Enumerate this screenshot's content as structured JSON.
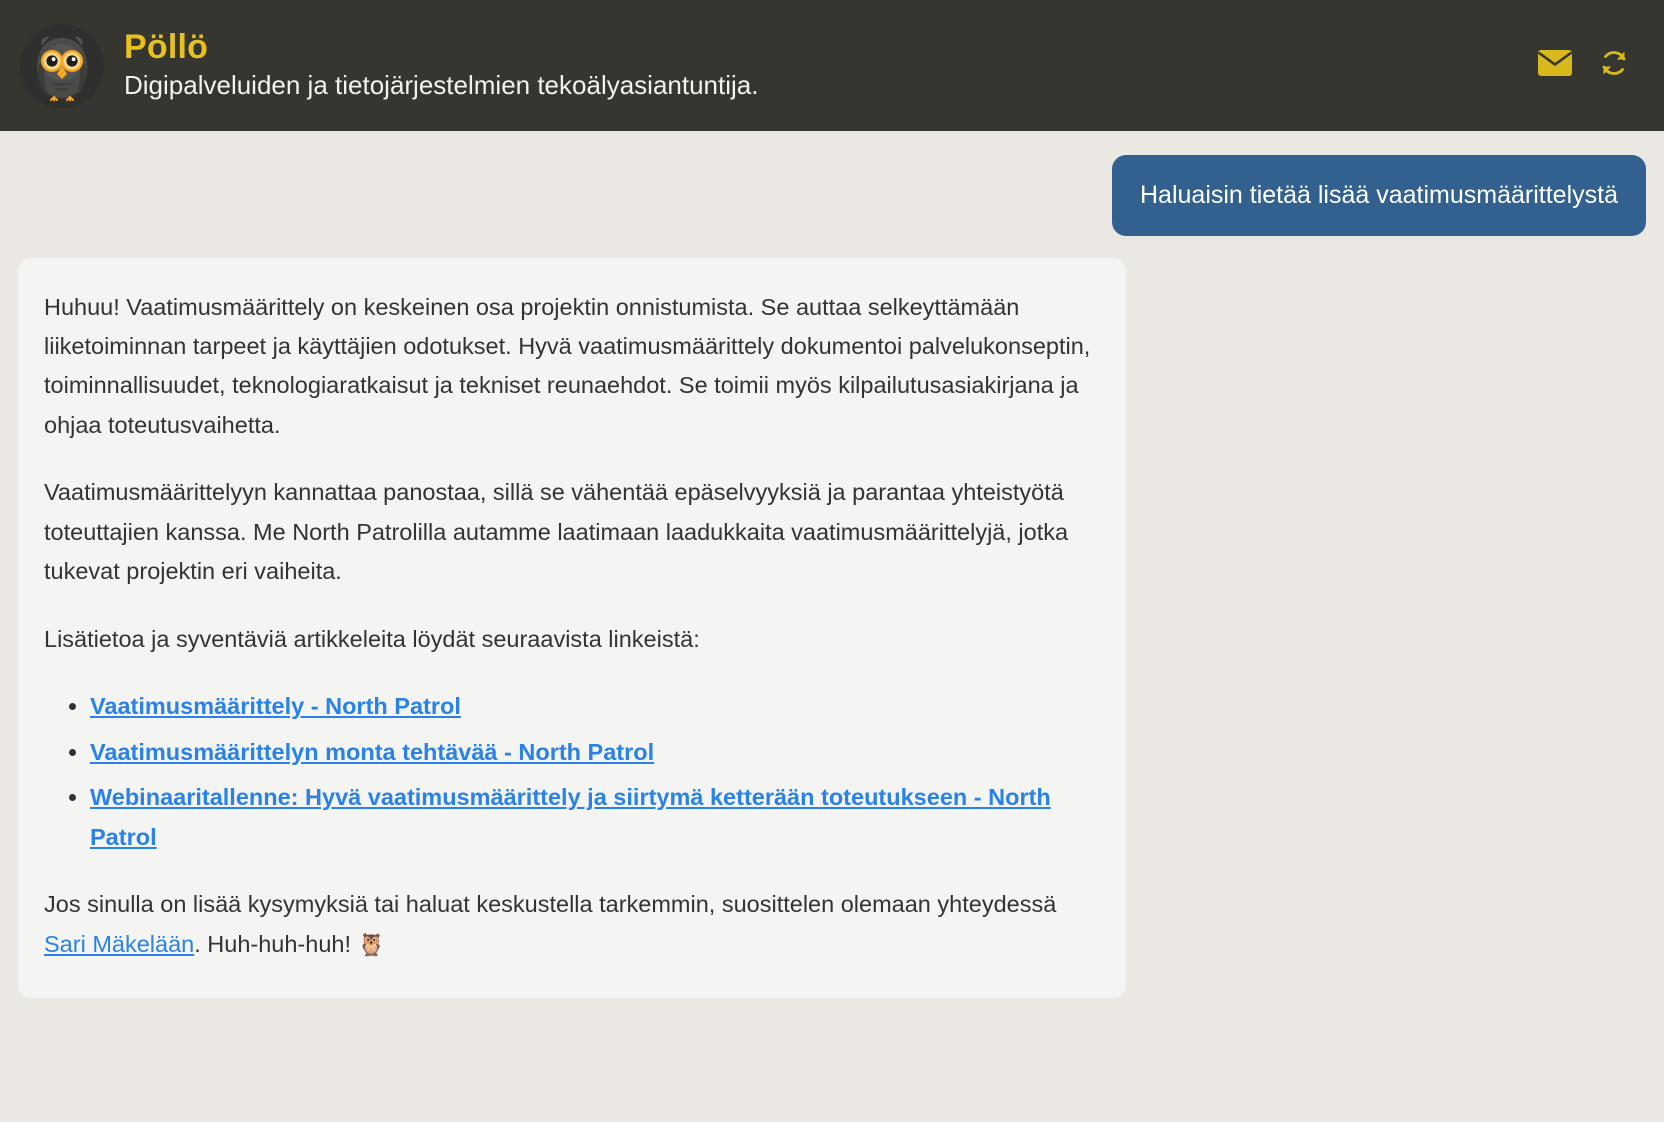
{
  "header": {
    "brand_title": "Pöllö",
    "tagline": "Digipalveluiden ja tietojärjestelmien tekoälyasiantuntija.",
    "avatar_icon": "owl-avatar",
    "actions": [
      {
        "icon": "envelope-icon",
        "name": "email-button"
      },
      {
        "icon": "refresh-icon",
        "name": "refresh-button"
      }
    ],
    "colors": {
      "background": "#363630",
      "title": "#e8c020",
      "tagline": "#f2f2ef",
      "icon": "#d8b81c"
    }
  },
  "page": {
    "background": "#ebe8e3"
  },
  "conversation": {
    "user_message": {
      "text": "Haluaisin tietää lisää vaatimusmäärittelystä",
      "bubble_color": "#33618f",
      "text_color": "#ffffff"
    },
    "assistant_message": {
      "bubble_color": "#f4f4f3",
      "text_color": "#333333",
      "link_color": "#2a82e8",
      "paragraph_1": "Huhuu! Vaatimusmäärittely on keskeinen osa projektin onnistumista. Se auttaa selkeyttämään liiketoiminnan tarpeet ja käyttäjien odotukset. Hyvä vaatimusmäärittely dokumentoi palvelukonseptin, toiminnallisuudet, teknologiaratkaisut ja tekniset reunaehdot. Se toimii myös kilpailutusasiakirjana ja ohjaa toteutusvaihetta.",
      "paragraph_2": "Vaatimusmäärittelyyn kannattaa panostaa, sillä se vähentää epäselvyyksiä ja parantaa yhteistyötä toteuttajien kanssa. Me North Patrolilla autamme laatimaan laadukkaita vaatimusmäärittelyjä, jotka tukevat projektin eri vaiheita.",
      "paragraph_3": "Lisätietoa ja syventäviä artikkeleita löydät seuraavista linkeistä:",
      "links": [
        "Vaatimusmäärittely - North Patrol",
        "Vaatimusmäärittelyn monta tehtävää - North Patrol",
        "Webinaaritallenne: Hyvä vaatimusmäärittely ja siirtymä ketterään toteutukseen - North Patrol"
      ],
      "closing_prefix": "Jos sinulla on lisää kysymyksiä tai haluat keskustella tarkemmin, suosittelen olemaan yhteydessä ",
      "closing_link": "Sari Mäkelään",
      "closing_suffix": ". Huh-huh-huh! ",
      "closing_emoji": "🦉"
    }
  }
}
